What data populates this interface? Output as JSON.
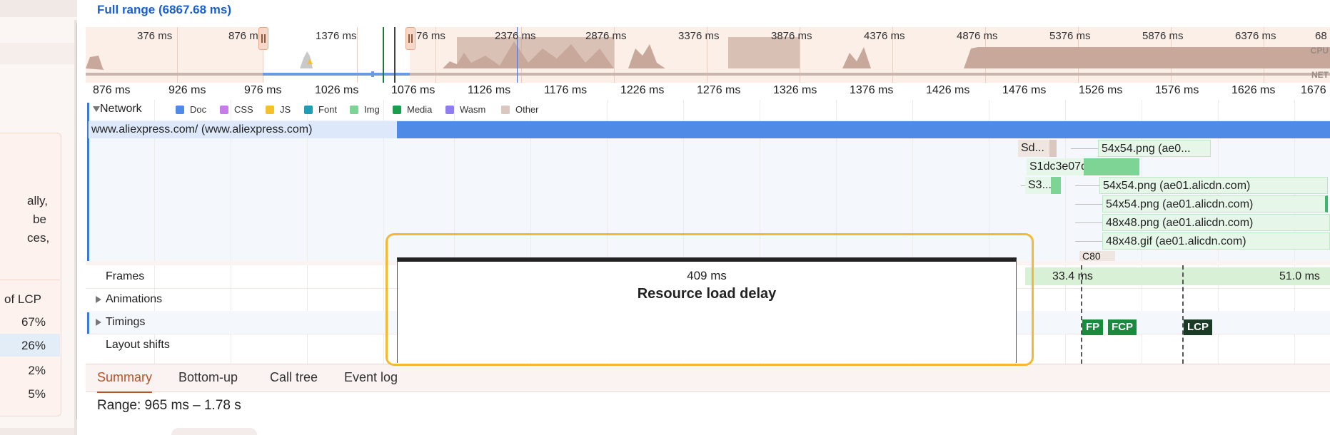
{
  "header": {
    "full_range": "Full range (6867.68 ms)"
  },
  "left_panel": {
    "fragments": [
      "ally,",
      "be",
      "ces,"
    ],
    "lcp_header": "of LCP",
    "percentages": [
      "67%",
      "26%",
      "2%",
      "5%"
    ]
  },
  "overview": {
    "ticks": [
      "376 ms",
      "876 m",
      "1376 ms",
      "76 ms",
      "2376 ms",
      "2876 ms",
      "3376 ms",
      "3876 ms",
      "4376 ms",
      "4876 ms",
      "5376 ms",
      "5876 ms",
      "6376 ms",
      "68"
    ],
    "cpu_label": "CPU",
    "net_label": "NET"
  },
  "ruler": {
    "ticks": [
      "876 ms",
      "926 ms",
      "976 ms",
      "1026 ms",
      "1076 ms",
      "1126 ms",
      "1176 ms",
      "1226 ms",
      "1276 ms",
      "1326 ms",
      "1376 ms",
      "1426 ms",
      "1476 ms",
      "1526 ms",
      "1576 ms",
      "1626 ms",
      "1676"
    ]
  },
  "network": {
    "title": "Network",
    "legend": [
      {
        "label": "Doc",
        "color": "#4f8ae6"
      },
      {
        "label": "CSS",
        "color": "#c77de8"
      },
      {
        "label": "JS",
        "color": "#f5c02b"
      },
      {
        "label": "Font",
        "color": "#1e9db3"
      },
      {
        "label": "Img",
        "color": "#7ed495"
      },
      {
        "label": "Media",
        "color": "#1a9e4d"
      },
      {
        "label": "Wasm",
        "color": "#8f7cf0"
      },
      {
        "label": "Other",
        "color": "#d9c7c0"
      }
    ],
    "requests": {
      "main_doc": "www.aliexpress.com/ (www.aliexpress.com)",
      "sd": "Sd...",
      "img1": "54x54.png (ae0...",
      "s1dc": "S1dc3e07d0142...",
      "s3": "S3...",
      "img2": "54x54.png (ae01.alicdn.com)",
      "img3": "54x54.png (ae01.alicdn.com)",
      "img4": "48x48.png (ae01.alicdn.com)",
      "img5": "48x48.gif (ae01.alicdn.com)",
      "c80": "C80"
    }
  },
  "tracks": {
    "frames": "Frames",
    "frame_time_1": "33.4 ms",
    "frame_time_2": "51.0 ms",
    "animations": "Animations",
    "timings": "Timings",
    "layout_shifts": "Layout shifts"
  },
  "markers": {
    "fp": "FP",
    "fcp": "FCP",
    "lcp": "LCP"
  },
  "tooltip": {
    "duration": "409 ms",
    "label": "Resource load delay"
  },
  "bottom": {
    "tabs": [
      "Summary",
      "Bottom-up",
      "Call tree",
      "Event log"
    ],
    "active_tab": "Summary",
    "range": "Range: 965 ms – 1.78 s"
  }
}
